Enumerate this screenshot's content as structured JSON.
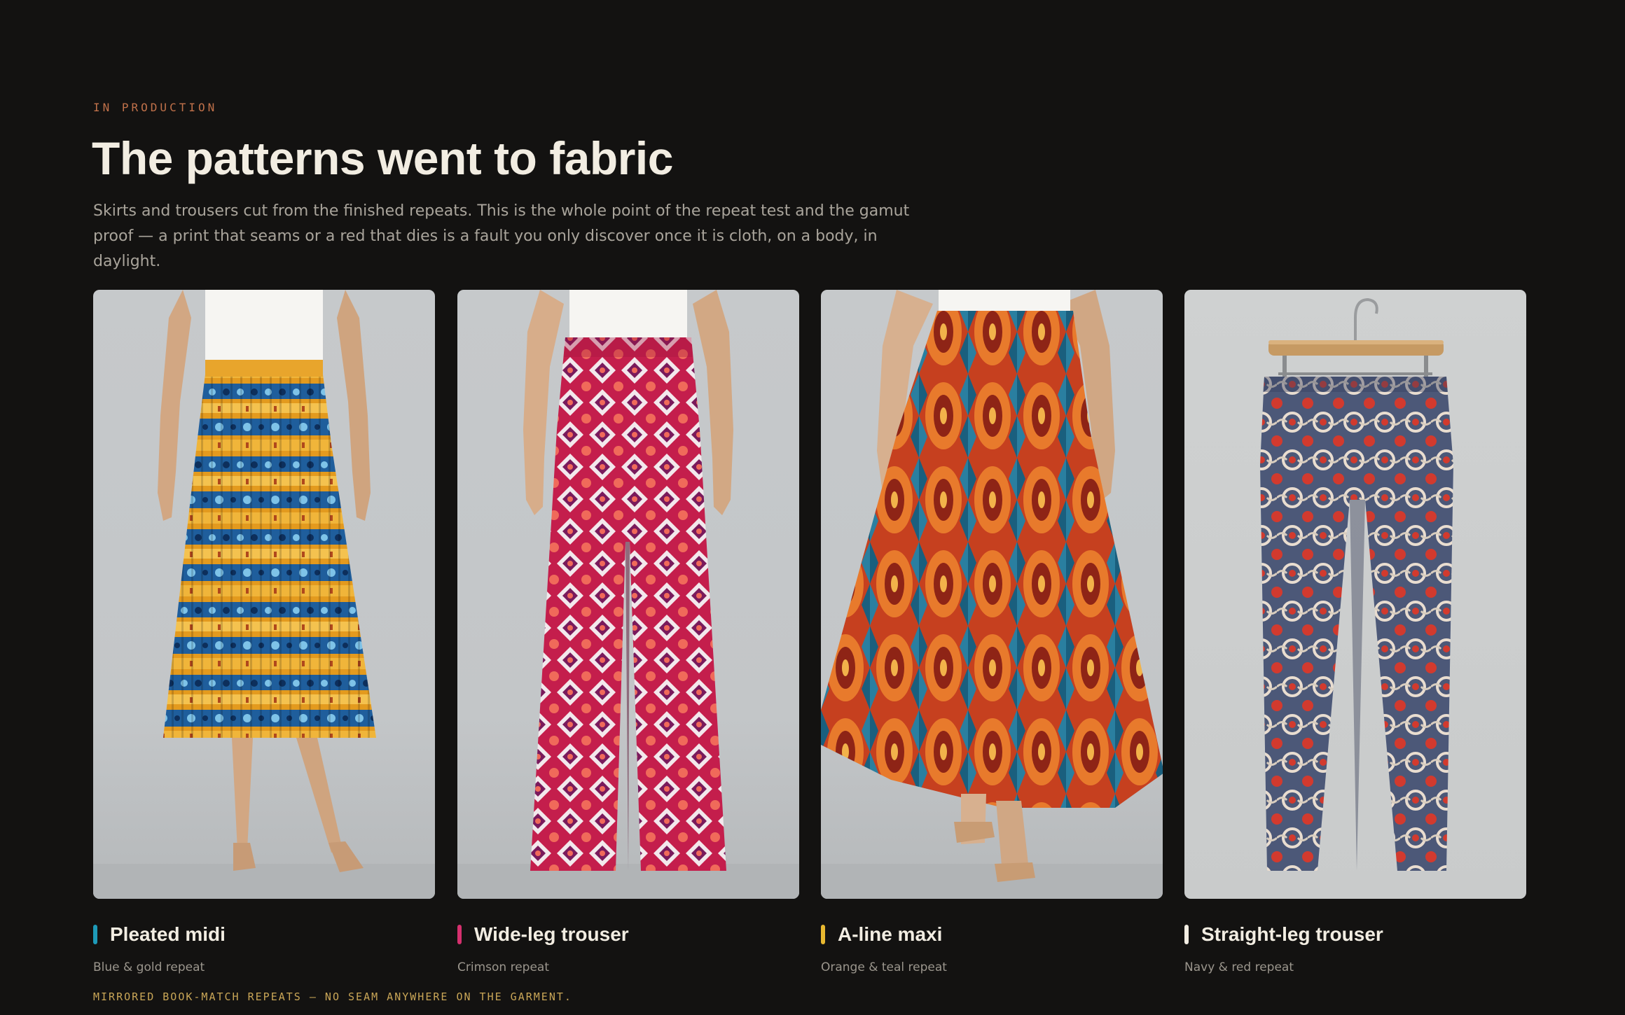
{
  "header": {
    "eyebrow": "IN PRODUCTION",
    "title": "The patterns went to fabric",
    "lede": "Skirts and trousers cut from the finished repeats. This is the whole point of the repeat test and the gamut proof — a print that seams or a red that dies is a fault you only discover once it is cloth, on a body, in daylight."
  },
  "garments": [
    {
      "name": "Pleated midi",
      "subtitle": "Blue & gold repeat",
      "accent": "#1e9ab8",
      "image": "model-wearing-pleated-midi-skirt"
    },
    {
      "name": "Wide-leg trouser",
      "subtitle": "Crimson repeat",
      "accent": "#d6306e",
      "image": "model-wearing-wide-leg-trousers"
    },
    {
      "name": "A-line maxi",
      "subtitle": "Orange & teal repeat",
      "accent": "#e8b830",
      "image": "model-wearing-a-line-maxi-skirt"
    },
    {
      "name": "Straight-leg trouser",
      "subtitle": "Navy & red repeat",
      "accent": "#f2ede2",
      "image": "trousers-on-wooden-hanger"
    }
  ],
  "footnote": "MIRRORED BOOK-MATCH REPEATS — NO SEAM ANYWHERE ON THE GARMENT."
}
